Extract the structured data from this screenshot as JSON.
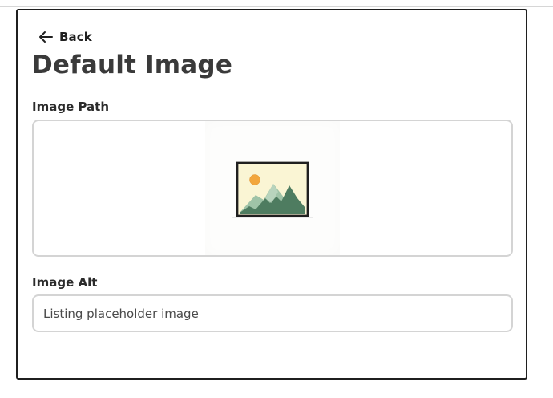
{
  "header": {
    "back_label": "Back",
    "title": "Default Image"
  },
  "fields": {
    "image_path": {
      "label": "Image Path",
      "preview_icon": "landscape-image-icon"
    },
    "image_alt": {
      "label": "Image Alt",
      "value": "Listing placeholder image"
    }
  },
  "colors": {
    "panel_border": "#1f1f1f",
    "input_border": "#d4d4d4",
    "title_text": "#3a3a3a",
    "image_sky": "#faf5d4",
    "image_sun": "#f2a63d",
    "image_mountain_dark": "#4e7c60",
    "image_mountain_light": "#9fc3a7"
  }
}
